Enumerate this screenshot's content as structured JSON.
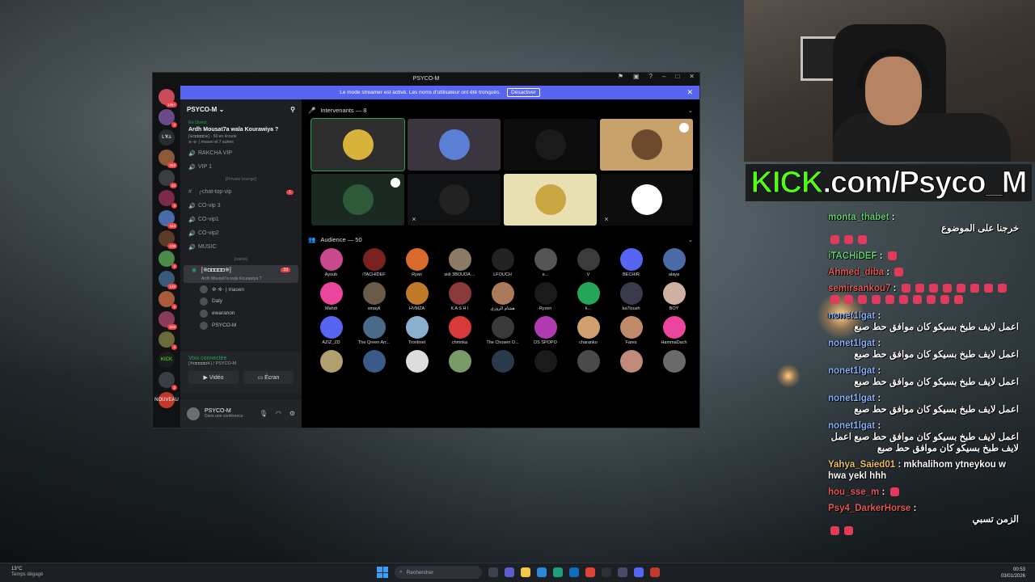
{
  "discord": {
    "window_title": "PSYCO-M",
    "banner_text": "Le mode streamer est activé. Les noms d'utilisateur ont été tronqués.",
    "banner_button": "Désactiver",
    "server_badges": [
      "146+",
      "2",
      "L'Ks",
      "262",
      "36",
      "4",
      "444",
      "109",
      "4",
      "140",
      "6",
      "603",
      "4",
      "KICK",
      "2",
      "NOUVEAU"
    ],
    "guild_name": "PSYCO-M",
    "event": {
      "status": "En Direct",
      "title": "Ardh Mousat7a wala Kourawiya ?",
      "info": "[※◘◘◘◘◘※] · 50 en écoute",
      "speakers": "※·※· | masen et 7 autres"
    },
    "channels": [
      {
        "kind": "voice",
        "name": "RAKCHA VIP"
      },
      {
        "kind": "voice",
        "name": "VIP 1"
      },
      {
        "kind": "category",
        "name": "[Private lounge]"
      },
      {
        "kind": "text",
        "name": "┌chat-top-vip",
        "unread": "1"
      },
      {
        "kind": "voice",
        "name": "CO-vip 3"
      },
      {
        "kind": "voice",
        "name": "CO-vip1"
      },
      {
        "kind": "voice",
        "name": "CO-vip2"
      },
      {
        "kind": "voice",
        "name": "MUSIC"
      },
      {
        "kind": "category",
        "name": "[salon]"
      }
    ],
    "active_stage": {
      "name": "[※◘◘◘◘◘※]",
      "subtitle": "Ardh Mousat7a wala Kourawiya ?",
      "count": "33"
    },
    "stage_members": [
      "※·※· | masen",
      "Daly",
      "ewaranon",
      "PSYCO-M"
    ],
    "voice": {
      "status": "Voix connectée",
      "channel": "[※◘◘◘◘◘※] / PSYCO-M",
      "video_label": "Vidéo",
      "screen_label": "Écran"
    },
    "user": {
      "name": "PSYCO-M",
      "status": "Dans une conférence"
    },
    "speakers_header": "Intervenants — 8",
    "audience_header": "Audience — 50",
    "speaker_tiles": [
      {
        "bg": "#2e2e2e",
        "border": "#23a55a",
        "avatar": "#d8b33c",
        "mute": false,
        "shield": false
      },
      {
        "bg": "#3b3540",
        "border": "",
        "avatar": "#5c7fd6",
        "mute": false,
        "shield": false
      },
      {
        "bg": "#0d0d0d",
        "border": "",
        "avatar": "#1a1a1a",
        "mute": false,
        "shield": false
      },
      {
        "bg": "#c8a26a",
        "border": "",
        "avatar": "#6b4a2e",
        "mute": false,
        "shield": true
      },
      {
        "bg": "#1b2a20",
        "border": "",
        "avatar": "#2f5a3a",
        "mute": false,
        "shield": true
      },
      {
        "bg": "#111214",
        "border": "",
        "avatar": "#222222",
        "mute": true,
        "shield": false
      },
      {
        "bg": "#e8e0b0",
        "border": "",
        "avatar": "#c9a640",
        "mute": true,
        "shield": false
      },
      {
        "bg": "#0d0d0d",
        "border": "",
        "avatar": "#ffffff",
        "mute": true,
        "shield": false
      }
    ],
    "audience": [
      {
        "name": "Ayoub",
        "color": "#c94a8c"
      },
      {
        "name": "iTACHIDEF",
        "color": "#7a2222"
      },
      {
        "name": "Ryan",
        "color": "#d86a2c"
      },
      {
        "name": "sidi 3BOUDA ...",
        "color": "#8a7a66"
      },
      {
        "name": "LFOUCH",
        "color": "#222222"
      },
      {
        "name": "e...",
        "color": "#555555"
      },
      {
        "name": "V",
        "color": "#3b3b3b"
      },
      {
        "name": "BECHIR",
        "color": "#5865f2"
      },
      {
        "name": "alaya",
        "color": "#4a6aa8"
      },
      {
        "name": "Mahdi",
        "color": "#eb459e"
      },
      {
        "name": "smayli",
        "color": "#6a5a48"
      },
      {
        "name": "HVMZA",
        "color": "#c07a2a"
      },
      {
        "name": "K A S H I",
        "color": "#8a3a3a"
      },
      {
        "name": "هشام الزوزي",
        "color": "#aa7a5a"
      },
      {
        "name": "Ryzen",
        "color": "#1a1a1a"
      },
      {
        "name": "k...",
        "color": "#23a55a"
      },
      {
        "name": "ka7loush",
        "color": "#3a3a4a"
      },
      {
        "name": "BOY",
        "color": "#d0b0a0"
      },
      {
        "name": "AZIZ_ZD",
        "color": "#5865f2"
      },
      {
        "name": "The Qreen Arr...",
        "color": "#4a6a8a"
      },
      {
        "name": "Trontinet",
        "color": "#8ab0d0"
      },
      {
        "name": "chmnka",
        "color": "#d83a3a"
      },
      {
        "name": "The Chosen O...",
        "color": "#3a3a3a"
      },
      {
        "name": "DS SPOPO",
        "color": "#b03ab0"
      },
      {
        "name": "charanko",
        "color": "#d0a070"
      },
      {
        "name": "Fares",
        "color": "#c08a6a"
      },
      {
        "name": "HammaDach",
        "color": "#eb459e"
      },
      {
        "name": "",
        "color": "#b0a070"
      },
      {
        "name": "",
        "color": "#3a5a8a"
      },
      {
        "name": "",
        "color": "#dddddd"
      },
      {
        "name": "",
        "color": "#7a9a6a"
      },
      {
        "name": "",
        "color": "#2a3a4a"
      },
      {
        "name": "",
        "color": "#1a1a1a"
      },
      {
        "name": "",
        "color": "#4a4a4a"
      },
      {
        "name": "",
        "color": "#c08a7a"
      },
      {
        "name": "",
        "color": "#6a6a6a"
      }
    ]
  },
  "kick": {
    "logo": "KICK",
    "url": ".com/Psyco_M"
  },
  "chat": [
    {
      "user": "monta_thabet",
      "text": "خرجنا على الموضوع",
      "emotes": 3,
      "tone": "t1"
    },
    {
      "user": "iTACHiDEF",
      "text": "",
      "emotes": 1,
      "tone": "t1"
    },
    {
      "user": "Ahmed_diba",
      "text": "",
      "emotes": 1,
      "tone": "t2"
    },
    {
      "user": "semirsankou7",
      "text": "",
      "emotes": 18,
      "tone": "t2"
    },
    {
      "user": "nonet1lgat",
      "text": "اعمل لايف طبخ بسيكو كان موافق حط صبع",
      "emotes": 0,
      "tone": "t3"
    },
    {
      "user": "nonet1lgat",
      "text": "اعمل لايف طبخ بسيكو كان موافق حط صبع",
      "emotes": 0,
      "tone": "t3"
    },
    {
      "user": "nonet1lgat",
      "text": "اعمل لايف طبخ بسيكو كان موافق حط صبع",
      "emotes": 0,
      "tone": "t3"
    },
    {
      "user": "nonet1lgat",
      "text": "اعمل لايف طبخ بسيكو كان موافق حط صبع",
      "emotes": 0,
      "tone": "t3"
    },
    {
      "user": "nonet1lgat",
      "text": "اعمل لايف طبخ بسيكو كان موافق حط صبع اعمل لايف طبخ بسيكو كان موافق حط صبع",
      "emotes": 0,
      "tone": "t3"
    },
    {
      "user": "Yahya_Saied01",
      "text": "mkhalihom ytneykou w hwa yekl hhh",
      "emotes": 0,
      "tone": "t4"
    },
    {
      "user": "hou_sse_m",
      "text": "",
      "emotes": 1,
      "tone": "t2"
    },
    {
      "user": "Psy4_DarkerHorse",
      "text": "الزمن تسبي",
      "emotes": 2,
      "tone": "t2"
    }
  ],
  "taskbar": {
    "temp": "13°C",
    "weather": "Temps dégagé",
    "search_placeholder": "Rechercher",
    "time": "00:53",
    "date": "03/01/2026"
  },
  "colors": {
    "blurple": "#5865f2",
    "kick_green": "#53fc18",
    "online": "#23a55a"
  }
}
